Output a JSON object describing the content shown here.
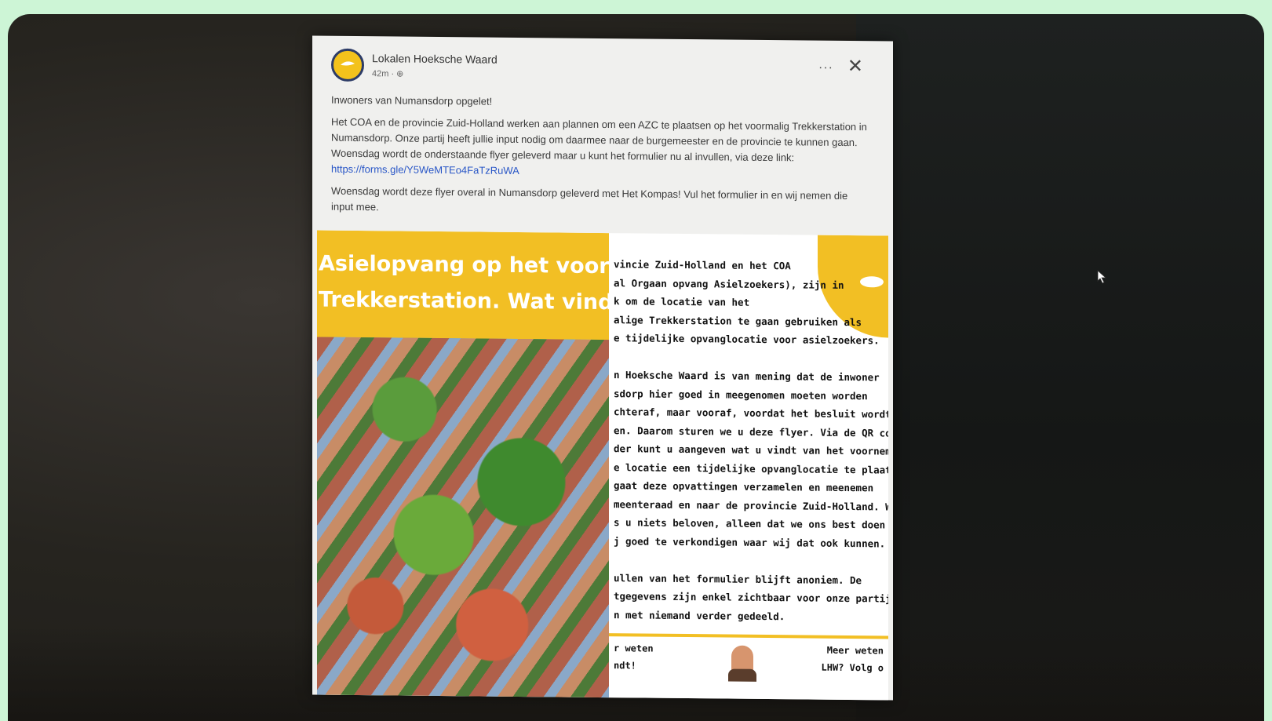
{
  "post": {
    "page_name": "Lokalen Hoeksche Waard",
    "meta": "42m · ⊕",
    "more_label": "···",
    "close_label": "✕",
    "paragraph1": "Inwoners van Numansdorp opgelet!",
    "paragraph2": "Het COA en de provincie Zuid-Holland werken aan plannen om een AZC te plaatsen op het voormalig Trekkerstation in Numansdorp. Onze partij heeft jullie input nodig om daarmee naar de burgemeester en de provincie te kunnen gaan. Woensdag wordt de onderstaande flyer geleverd maar u kunt het formulier nu al invullen, via deze link: ",
    "link": "https://forms.gle/Y5WeMTEo4FaTzRuWA",
    "paragraph3": "Woensdag wordt deze flyer overal in Numansdorp geleverd met Het Kompas! Vul het formulier in en wij nemen die input mee."
  },
  "flyer": {
    "headline_line1": "Asielopvang op het voorma",
    "headline_line2": "Trekkerstation. Wat vindt u",
    "text_para1": [
      "vincie Zuid-Holland en het COA",
      "al Orgaan opvang Asielzoekers), zijn in",
      "k om de locatie van het",
      "alige Trekkerstation te gaan gebruiken als",
      "e tijdelijke opvanglocatie voor asielzoekers."
    ],
    "text_para2": [
      "n Hoeksche Waard is van mening dat de inwoner",
      "sdorp hier goed in meegenomen moeten worden",
      "chteraf, maar vooraf, voordat het besluit wordt",
      "en. Daarom sturen we u deze flyer. Via de QR co",
      "der kunt u aangeven wat u vindt van het voornem",
      "e locatie een tijdelijke opvanglocatie te plaatsen",
      "gaat deze opvattingen verzamelen en meenemen",
      "meenteraad en naar de provincie Zuid-Holland. W",
      "s u niets beloven, alleen dat we ons best doen o",
      "j goed te verkondigen waar wij dat ook kunnen."
    ],
    "text_para3": [
      "ullen van het formulier blijft anoniem. De",
      "tgegevens zijn enkel zichtbaar voor onze partij z",
      "n met niemand verder gedeeld."
    ],
    "footer_left": [
      "r weten",
      "ndt!"
    ],
    "footer_right": [
      "Meer weten",
      "LHW? Volg o"
    ]
  }
}
